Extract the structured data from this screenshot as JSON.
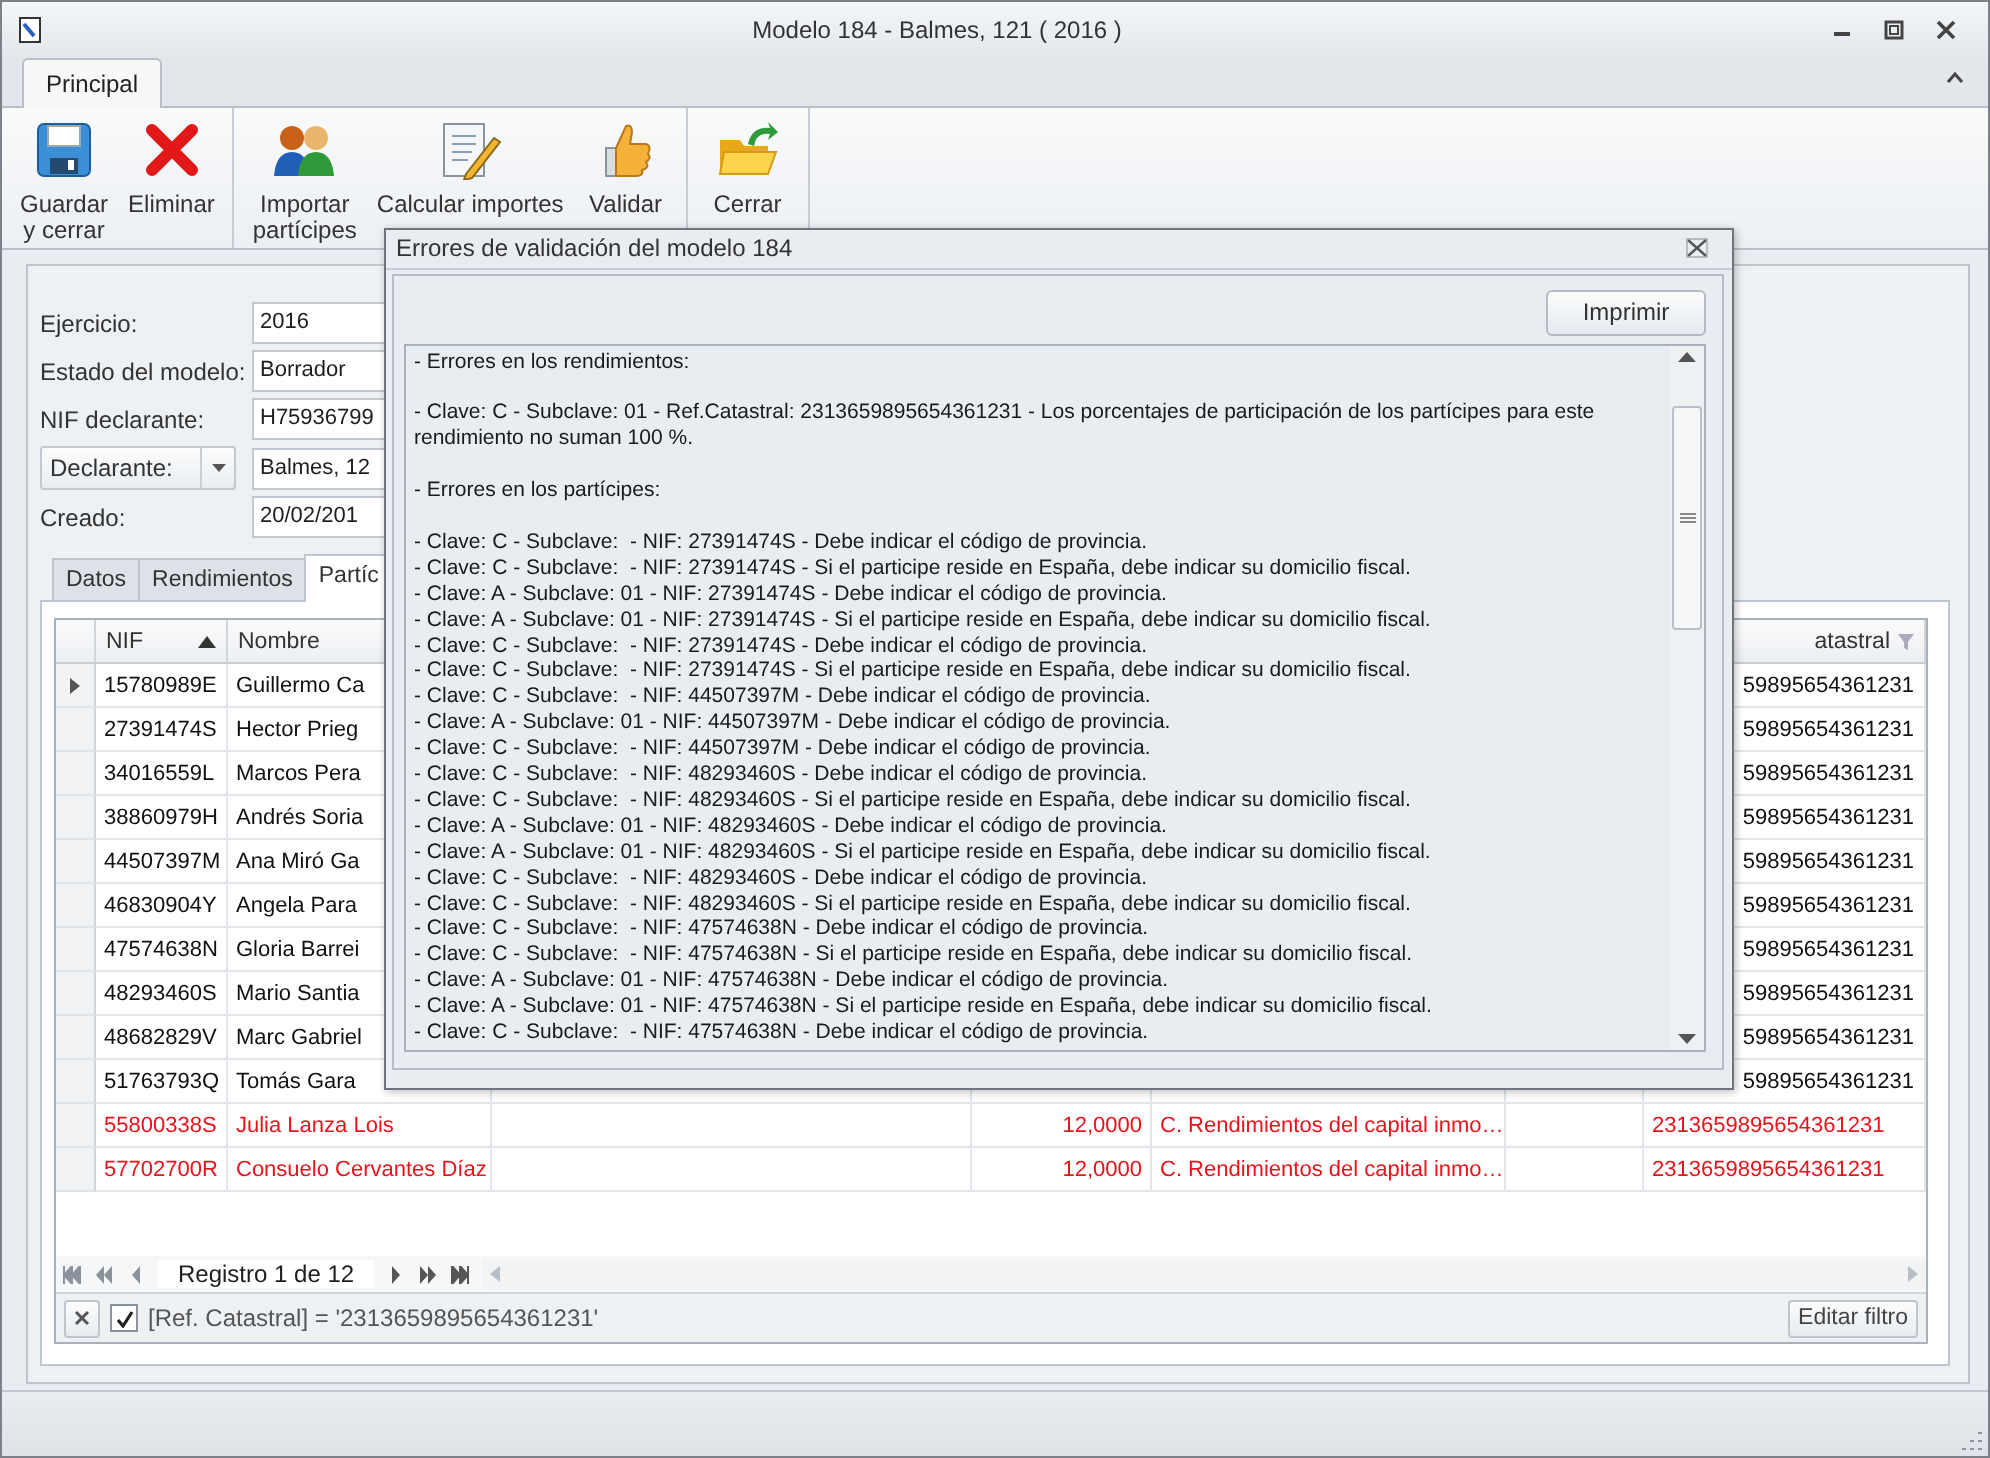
{
  "window": {
    "title": "Modelo 184 - Balmes, 121 ( 2016 )"
  },
  "ribbon": {
    "tabs": [
      {
        "label": "Principal",
        "selected": true
      }
    ],
    "groups": [
      {
        "buttons": [
          {
            "kind": "save",
            "label": "Guardar\ny cerrar"
          },
          {
            "kind": "delete",
            "label": "Eliminar"
          }
        ]
      },
      {
        "buttons": [
          {
            "kind": "import",
            "label": "Importar\npartícipes"
          },
          {
            "kind": "calculate",
            "label": "Calcular importes"
          },
          {
            "kind": "validate",
            "label": "Validar"
          }
        ]
      },
      {
        "buttons": [
          {
            "kind": "close",
            "label": "Cerrar"
          }
        ]
      }
    ]
  },
  "form": [
    {
      "kind": "text",
      "label": "Ejercicio:",
      "value": "2016"
    },
    {
      "kind": "text",
      "label": "Estado del modelo:",
      "value": "Borrador"
    },
    {
      "kind": "text",
      "label": "NIF declarante:",
      "value": "H75936799"
    },
    {
      "kind": "combo",
      "label": "Declarante:",
      "value": "Balmes, 12"
    },
    {
      "kind": "text",
      "label": "Creado:",
      "value": "20/02/201"
    }
  ],
  "tabs": [
    {
      "label": "Datos",
      "selected": false
    },
    {
      "label": "Rendimientos",
      "selected": false
    },
    {
      "label": "Partíc",
      "selected": true
    }
  ],
  "grid": {
    "columns": {
      "nif": {
        "label": "NIF",
        "sorted": true
      },
      "nombre": {
        "label": "Nombre"
      },
      "ref_catastral": {
        "label": "atastral"
      }
    },
    "rows": [
      {
        "current": true,
        "error": false,
        "nif": "15780989E",
        "nombre": "Guillermo Ca",
        "ref_catastral": "59895654361231"
      },
      {
        "current": false,
        "error": false,
        "nif": "27391474S",
        "nombre": "Hector Prieg",
        "ref_catastral": "59895654361231"
      },
      {
        "current": false,
        "error": false,
        "nif": "34016559L",
        "nombre": "Marcos Pera",
        "ref_catastral": "59895654361231"
      },
      {
        "current": false,
        "error": false,
        "nif": "38860979H",
        "nombre": "Andrés Soria",
        "ref_catastral": "59895654361231"
      },
      {
        "current": false,
        "error": false,
        "nif": "44507397M",
        "nombre": "Ana Miró Ga",
        "ref_catastral": "59895654361231"
      },
      {
        "current": false,
        "error": false,
        "nif": "46830904Y",
        "nombre": "Angela Para",
        "ref_catastral": "59895654361231"
      },
      {
        "current": false,
        "error": false,
        "nif": "47574638N",
        "nombre": "Gloria Barrei",
        "ref_catastral": "59895654361231"
      },
      {
        "current": false,
        "error": false,
        "nif": "48293460S",
        "nombre": "Mario Santia",
        "ref_catastral": "59895654361231"
      },
      {
        "current": false,
        "error": false,
        "nif": "48682829V",
        "nombre": "Marc Gabriel",
        "ref_catastral": "59895654361231"
      },
      {
        "current": false,
        "error": false,
        "nif": "51763793Q",
        "nombre": "Tomás Gara",
        "ref_catastral": "59895654361231"
      },
      {
        "current": false,
        "error": true,
        "nif": "55800338S",
        "nombre": "Julia Lanza Lois",
        "porcentaje": "12,0000",
        "clave": "C. Rendimientos del capital inmo…",
        "ref_catastral": "2313659895654361231"
      },
      {
        "current": false,
        "error": true,
        "nif": "57702700R",
        "nombre": "Consuelo Cervantes Díaz",
        "porcentaje": "12,0000",
        "clave": "C. Rendimientos del capital inmo…",
        "ref_catastral": "2313659895654361231"
      }
    ],
    "navigator": "Registro 1 de 12",
    "filter": {
      "enabled": true,
      "expression": "[Ref. Catastral] = '2313659895654361231'",
      "edit_button": "Editar filtro"
    }
  },
  "dialog": {
    "title": "Errores de validación del modelo 184",
    "print_button": "Imprimir",
    "sections": [
      {
        "heading": "- Errores en los rendimientos:",
        "lines": [
          "- Clave: C - Subclave: 01 - Ref.Catastral: 2313659895654361231 - Los porcentajes de participación de los partícipes para este rendimiento no suman 100 %."
        ]
      },
      {
        "heading": "- Errores en los partícipes:",
        "lines": [
          "- Clave: C - Subclave:  - NIF: 27391474S - Debe indicar el código de provincia.",
          "- Clave: C - Subclave:  - NIF: 27391474S - Si el participe reside en España, debe indicar su domicilio fiscal.",
          "- Clave: A - Subclave: 01 - NIF: 27391474S - Debe indicar el código de provincia.",
          "- Clave: A - Subclave: 01 - NIF: 27391474S - Si el participe reside en España, debe indicar su domicilio fiscal.",
          "- Clave: C - Subclave:  - NIF: 27391474S - Debe indicar el código de provincia.",
          "- Clave: C - Subclave:  - NIF: 27391474S - Si el participe reside en España, debe indicar su domicilio fiscal.",
          "- Clave: C - Subclave:  - NIF: 44507397M - Debe indicar el código de provincia.",
          "- Clave: A - Subclave: 01 - NIF: 44507397M - Debe indicar el código de provincia.",
          "- Clave: C - Subclave:  - NIF: 44507397M - Debe indicar el código de provincia.",
          "- Clave: C - Subclave:  - NIF: 48293460S - Debe indicar el código de provincia.",
          "- Clave: C - Subclave:  - NIF: 48293460S - Si el participe reside en España, debe indicar su domicilio fiscal.",
          "- Clave: A - Subclave: 01 - NIF: 48293460S - Debe indicar el código de provincia.",
          "- Clave: A - Subclave: 01 - NIF: 48293460S - Si el participe reside en España, debe indicar su domicilio fiscal.",
          "- Clave: C - Subclave:  - NIF: 48293460S - Debe indicar el código de provincia.",
          "- Clave: C - Subclave:  - NIF: 48293460S - Si el participe reside en España, debe indicar su domicilio fiscal.",
          "- Clave: C - Subclave:  - NIF: 47574638N - Debe indicar el código de provincia.",
          "- Clave: C - Subclave:  - NIF: 47574638N - Si el participe reside en España, debe indicar su domicilio fiscal.",
          "- Clave: A - Subclave: 01 - NIF: 47574638N - Debe indicar el código de provincia.",
          "- Clave: A - Subclave: 01 - NIF: 47574638N - Si el participe reside en España, debe indicar su domicilio fiscal.",
          "- Clave: C - Subclave:  - NIF: 47574638N - Debe indicar el código de provincia."
        ]
      }
    ]
  }
}
